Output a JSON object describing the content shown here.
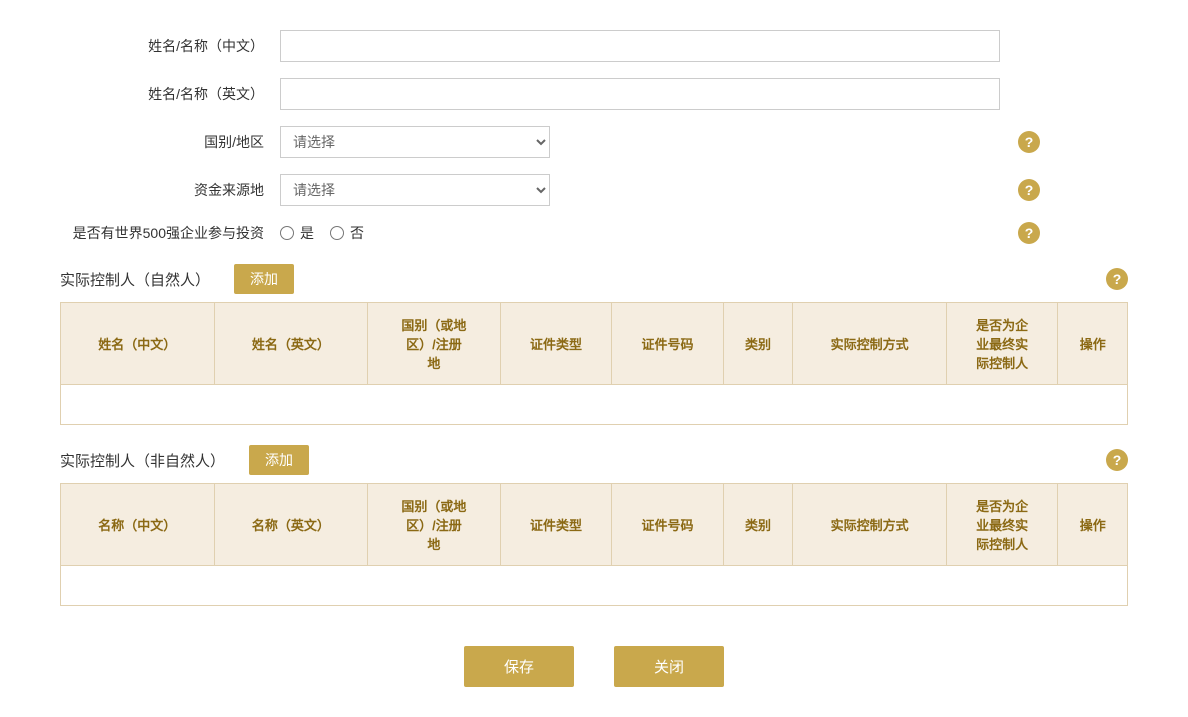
{
  "form": {
    "name_cn_label": "姓名/名称（中文）",
    "name_en_label": "姓名/名称（英文）",
    "country_label": "国别/地区",
    "country_placeholder": "请选择",
    "fund_source_label": "资金来源地",
    "fund_source_placeholder": "请选择",
    "fortune500_label": "是否有世界500强企业参与投资",
    "fortune500_yes": "是",
    "fortune500_no": "否",
    "name_cn_value": "",
    "name_en_value": ""
  },
  "section_natural": {
    "title": "实际控制人（自然人）",
    "add_button": "添加",
    "columns": [
      "姓名（中文）",
      "姓名（英文）",
      "国别（或地\n区）/注册\n地",
      "证件类型",
      "证件号码",
      "类别",
      "实际控制方式",
      "是否为企\n业最终实\n际控制人",
      "操作"
    ]
  },
  "section_non_natural": {
    "title": "实际控制人（非自然人）",
    "add_button": "添加",
    "columns": [
      "名称（中文）",
      "名称（英文）",
      "国别（或地\n区）/注册\n地",
      "证件类型",
      "证件号码",
      "类别",
      "实际控制方式",
      "是否为企\n业最终实\n际控制人",
      "操作"
    ]
  },
  "buttons": {
    "save": "保存",
    "close": "关闭"
  },
  "help_icon": "?"
}
